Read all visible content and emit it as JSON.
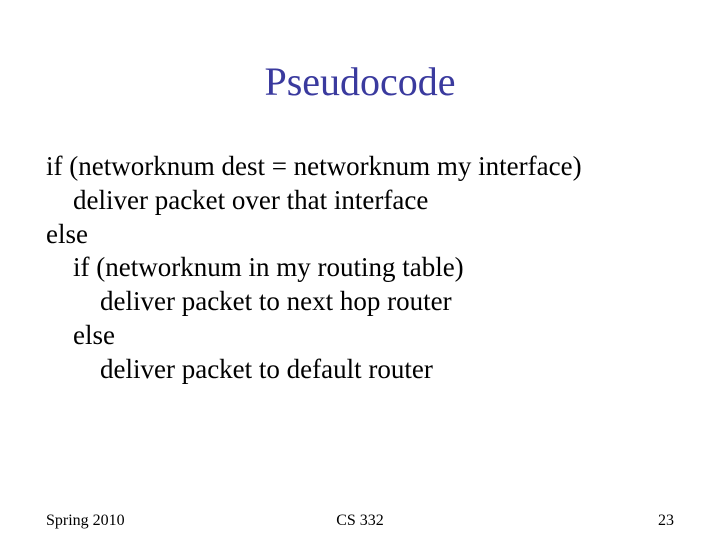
{
  "title": "Pseudocode",
  "body": {
    "lines": [
      {
        "indent": 0,
        "text": "if (networknum dest = networknum my interface)"
      },
      {
        "indent": 1,
        "text": "deliver packet over that interface"
      },
      {
        "indent": 0,
        "text": "else"
      },
      {
        "indent": 1,
        "text": "if (networknum in my routing table)"
      },
      {
        "indent": 2,
        "text": "deliver packet to next hop router"
      },
      {
        "indent": 1,
        "text": "else"
      },
      {
        "indent": 2,
        "text": "deliver packet to default router"
      }
    ]
  },
  "footer": {
    "left": "Spring 2010",
    "center": "CS 332",
    "right": "23"
  }
}
